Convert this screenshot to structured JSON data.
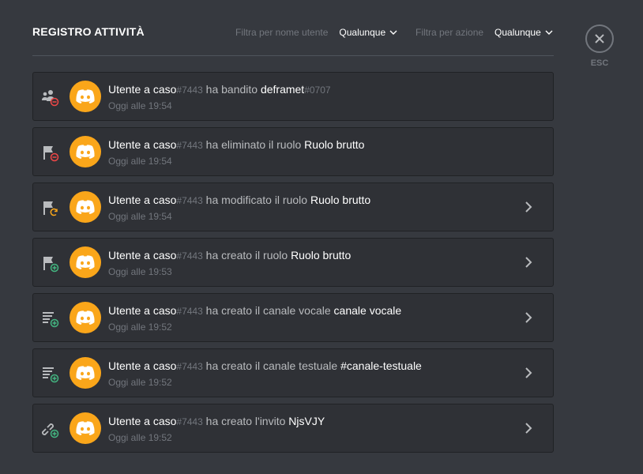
{
  "header": {
    "title": "REGISTRO ATTIVITÀ",
    "filter_user_label": "Filtra per nome utente",
    "filter_user_value": "Qualunque",
    "filter_action_label": "Filtra per azione",
    "filter_action_value": "Qualunque"
  },
  "close": {
    "label": "ESC"
  },
  "colors": {
    "background": "#36393f",
    "card": "#2f3136",
    "avatar": "#faa61a",
    "danger": "#f04747",
    "success": "#43b581",
    "warning": "#faa61a"
  },
  "entries": [
    {
      "icon": "member-ban-icon",
      "user": "Utente a caso",
      "disc": "#7443",
      "action": "ha bandito",
      "target": "deframet",
      "target_disc": "#0707",
      "time": "Oggi alle 19:54",
      "expandable": false
    },
    {
      "icon": "role-delete-icon",
      "user": "Utente a caso",
      "disc": "#7443",
      "action": "ha eliminato il ruolo",
      "target": "Ruolo brutto",
      "target_disc": "",
      "time": "Oggi alle 19:54",
      "expandable": false
    },
    {
      "icon": "role-update-icon",
      "user": "Utente a caso",
      "disc": "#7443",
      "action": "ha modificato il ruolo",
      "target": "Ruolo brutto",
      "target_disc": "",
      "time": "Oggi alle 19:54",
      "expandable": true
    },
    {
      "icon": "role-create-icon",
      "user": "Utente a caso",
      "disc": "#7443",
      "action": "ha creato il ruolo",
      "target": "Ruolo brutto",
      "target_disc": "",
      "time": "Oggi alle 19:53",
      "expandable": true
    },
    {
      "icon": "channel-create-icon",
      "user": "Utente a caso",
      "disc": "#7443",
      "action": "ha creato il canale vocale",
      "target": "canale vocale",
      "target_disc": "",
      "time": "Oggi alle 19:52",
      "expandable": true
    },
    {
      "icon": "channel-create-icon",
      "user": "Utente a caso",
      "disc": "#7443",
      "action": "ha creato il canale testuale",
      "target": "#canale-testuale",
      "target_disc": "",
      "time": "Oggi alle 19:52",
      "expandable": true
    },
    {
      "icon": "invite-create-icon",
      "user": "Utente a caso",
      "disc": "#7443",
      "action": "ha creato l'invito",
      "target": "NjsVJY",
      "target_disc": "",
      "time": "Oggi alle 19:52",
      "expandable": true
    }
  ]
}
